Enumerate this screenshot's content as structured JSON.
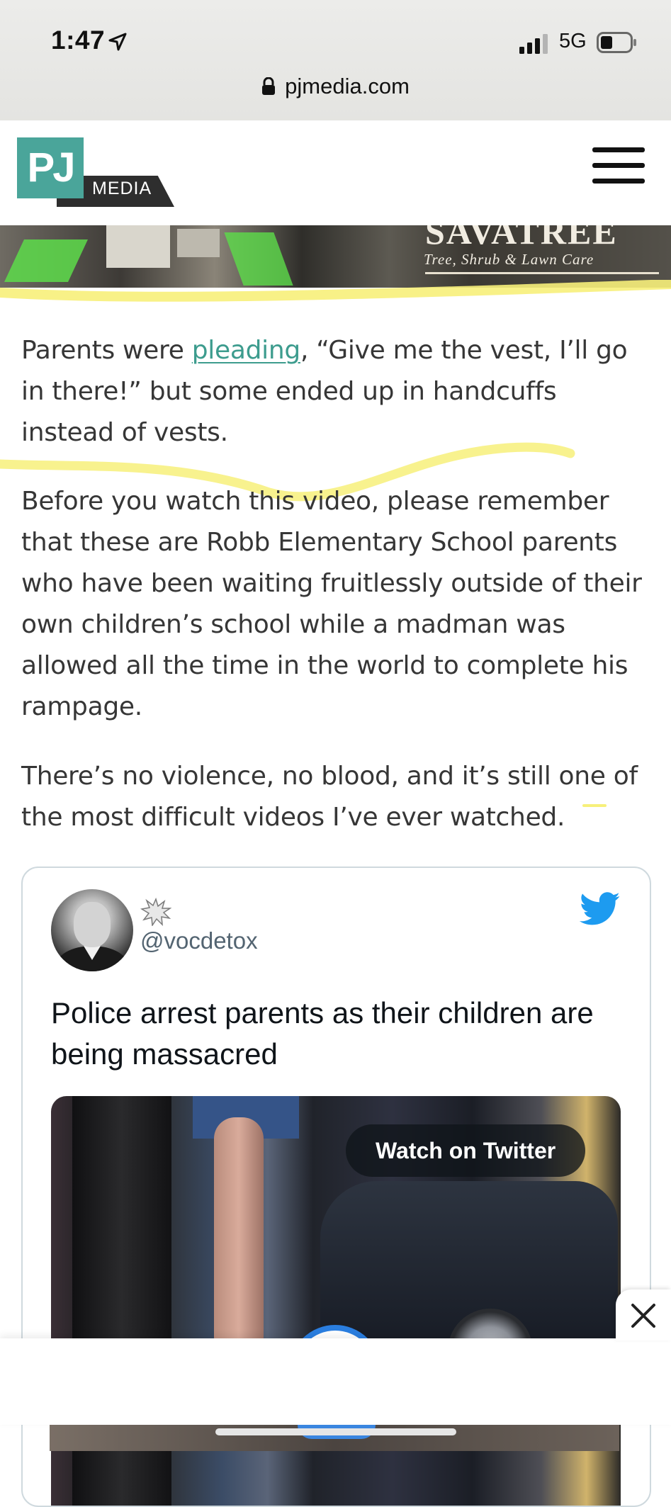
{
  "status_bar": {
    "time": "1:47",
    "network": "5G",
    "url": "pjmedia.com",
    "icons": [
      "location-arrow-icon",
      "signal-bars-icon",
      "battery-icon",
      "lock-icon"
    ]
  },
  "header": {
    "logo_pj": "PJ",
    "logo_media": "MEDIA",
    "logo_color": "#4aa59a",
    "menu_icon": "hamburger-menu-icon"
  },
  "ad_banner": {
    "brand": "SAVATREE",
    "tagline": "Tree, Shrub & Lawn Care"
  },
  "article": {
    "p1_before": "Parents were ",
    "p1_link": "pleading",
    "p1_after": ", “Give me the vest, I’ll go in there!” but some ended up in handcuffs instead of vests.",
    "p2": "Before you watch this video, please remember that these are Robb Elementary School parents who have been waiting fruitlessly outside of their own children’s school while a madman was allowed all the time in the world to complete his rampage.",
    "p3": "There’s no violence, no blood, and it’s still one of the most difficult videos I’ve ever watched.",
    "link_color": "#3d9c8e"
  },
  "tweet": {
    "handle": "@vocdetox",
    "text": "Police arrest parents as their children are being massacred",
    "watch_label": "Watch on Twitter",
    "bird_color": "#1d9bf0",
    "icons": [
      "avatar",
      "badge-icon",
      "twitter-bird-icon"
    ]
  },
  "sticky_ad": {
    "close_icon": "close-icon"
  },
  "highlight_color": "#f7f07a"
}
